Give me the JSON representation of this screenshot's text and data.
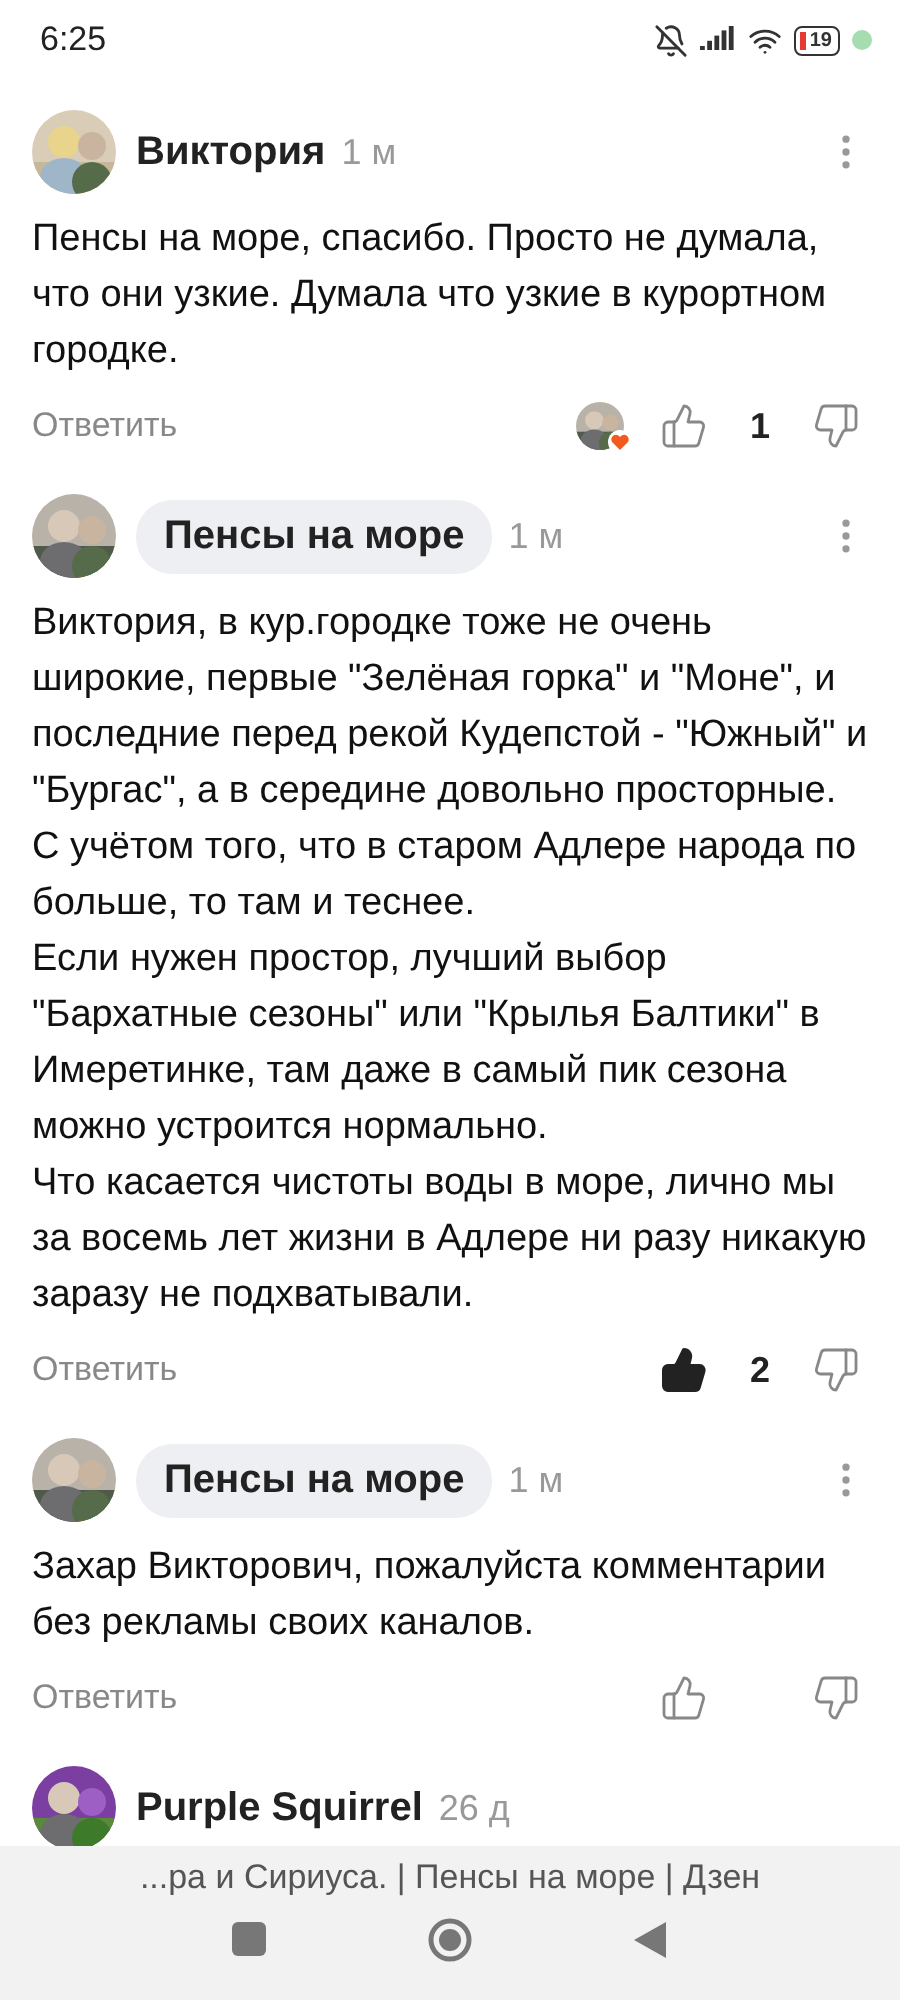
{
  "status_bar": {
    "time": "6:25",
    "battery": "19"
  },
  "comments": [
    {
      "author": "Виктория",
      "author_badge": false,
      "time": "1 м",
      "text": "Пенсы на море, спасибо. Просто не думала, что они узкие. Думала что узкие в курортном городке.",
      "reply": "Ответить",
      "reactor_avatar": true,
      "liked": false,
      "likes": "1"
    },
    {
      "author": "Пенсы на море",
      "author_badge": true,
      "time": "1 м",
      "text": "Виктория, в кур.городке тоже не очень широкие, первые \"Зелёная горка\" и \"Моне\", и последние перед рекой Кудепстой - \"Южный\" и \"Бургас\", а в середине довольно просторные.\nС учётом того, что в старом Адлере народа по больше, то там и теснее.\nЕсли нужен простор, лучший выбор \"Бархатные сезоны\" или \"Крылья Балтики\" в Имеретинке, там даже в самый пик сезона можно устроится нормально.\nЧто касается чистоты воды в море, лично мы за восемь лет жизни в Адлере ни разу никакую заразу не подхватывали.",
      "reply": "Ответить",
      "reactor_avatar": false,
      "liked": true,
      "likes": "2"
    },
    {
      "author": "Пенсы на море",
      "author_badge": true,
      "time": "1 м",
      "text": "Захар Викторович, пожалуйста комментарии без рекламы своих каналов.",
      "reply": "Ответить",
      "reactor_avatar": false,
      "liked": false
    }
  ],
  "partial_comment": {
    "author": "Purple Squirrel",
    "time": "26 д"
  },
  "bottom_bar": {
    "page_title": "...ра и Сириуса. | Пенсы на море | Дзен"
  }
}
